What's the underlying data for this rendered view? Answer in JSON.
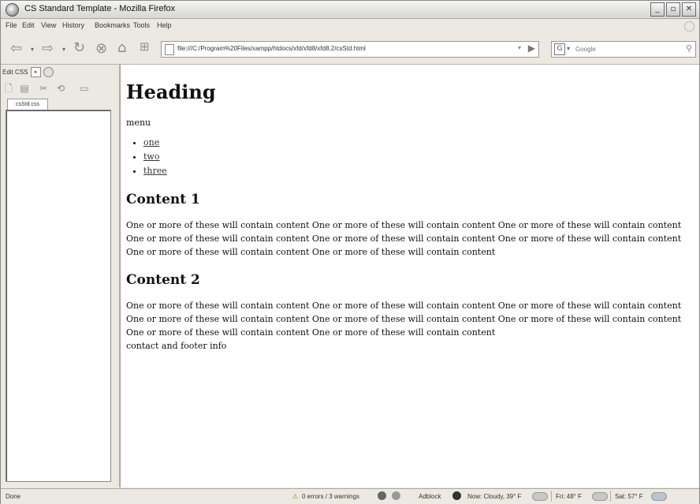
{
  "window": {
    "title": "CS Standard Template - Mozilla Firefox"
  },
  "menubar": [
    "File",
    "Edit",
    "View",
    "History",
    "Bookmarks",
    "Tools",
    "Help"
  ],
  "navbar": {
    "url": "file:///C:/Program%20Files/xampp/htdocs/xfd/xfd8/xfd8.2/csStd.html",
    "search_placeholder": "Google"
  },
  "sidebar": {
    "title": "Edit CSS",
    "tab": "csStd.css"
  },
  "page": {
    "heading": "Heading",
    "menu_label": "menu",
    "menu_items": [
      "one",
      "two",
      "three"
    ],
    "content1_title": "Content 1",
    "content1_text": "One or more of these will contain content One or more of these will contain content One or more of these will contain content One or more of these will contain content One or more of these will contain content One or more of these will contain content One or more of these will contain content One or more of these will contain content",
    "content2_title": "Content 2",
    "content2_text": "One or more of these will contain content One or more of these will contain content One or more of these will contain content One or more of these will contain content One or more of these will contain content One or more of these will contain content One or more of these will contain content One or more of these will contain content",
    "footer": "contact and footer info"
  },
  "statusbar": {
    "status": "Done",
    "errors": "0 errors / 3 warnings",
    "adblock": "Adblock",
    "weather_now": "Now: Cloudy, 39° F",
    "weather_fri": "Fri: 48° F",
    "weather_sat": "Sat: 57° F"
  },
  "icons": {
    "firefox": "firefox-icon",
    "back": "back-arrow-icon",
    "forward": "forward-arrow-icon",
    "reload": "reload-icon",
    "stop": "stop-icon",
    "home": "home-icon",
    "new_tab": "new-tab-icon",
    "go": "go-arrow-icon",
    "search": "magnifier-icon"
  }
}
